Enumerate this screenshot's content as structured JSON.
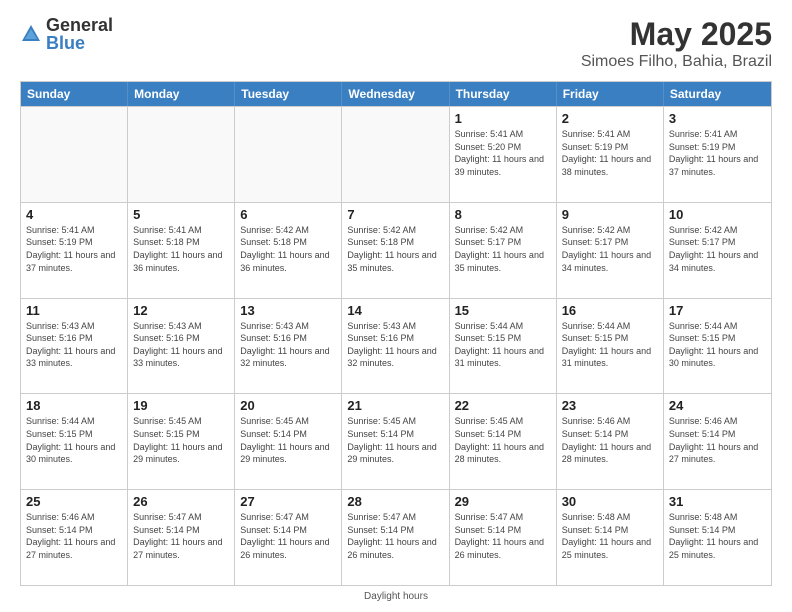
{
  "header": {
    "logo_general": "General",
    "logo_blue": "Blue",
    "title": "May 2025",
    "subtitle": "Simoes Filho, Bahia, Brazil"
  },
  "calendar": {
    "days_of_week": [
      "Sunday",
      "Monday",
      "Tuesday",
      "Wednesday",
      "Thursday",
      "Friday",
      "Saturday"
    ],
    "weeks": [
      [
        {
          "day": "",
          "info": ""
        },
        {
          "day": "",
          "info": ""
        },
        {
          "day": "",
          "info": ""
        },
        {
          "day": "",
          "info": ""
        },
        {
          "day": "1",
          "info": "Sunrise: 5:41 AM\nSunset: 5:20 PM\nDaylight: 11 hours and 39 minutes."
        },
        {
          "day": "2",
          "info": "Sunrise: 5:41 AM\nSunset: 5:19 PM\nDaylight: 11 hours and 38 minutes."
        },
        {
          "day": "3",
          "info": "Sunrise: 5:41 AM\nSunset: 5:19 PM\nDaylight: 11 hours and 37 minutes."
        }
      ],
      [
        {
          "day": "4",
          "info": "Sunrise: 5:41 AM\nSunset: 5:19 PM\nDaylight: 11 hours and 37 minutes."
        },
        {
          "day": "5",
          "info": "Sunrise: 5:41 AM\nSunset: 5:18 PM\nDaylight: 11 hours and 36 minutes."
        },
        {
          "day": "6",
          "info": "Sunrise: 5:42 AM\nSunset: 5:18 PM\nDaylight: 11 hours and 36 minutes."
        },
        {
          "day": "7",
          "info": "Sunrise: 5:42 AM\nSunset: 5:18 PM\nDaylight: 11 hours and 35 minutes."
        },
        {
          "day": "8",
          "info": "Sunrise: 5:42 AM\nSunset: 5:17 PM\nDaylight: 11 hours and 35 minutes."
        },
        {
          "day": "9",
          "info": "Sunrise: 5:42 AM\nSunset: 5:17 PM\nDaylight: 11 hours and 34 minutes."
        },
        {
          "day": "10",
          "info": "Sunrise: 5:42 AM\nSunset: 5:17 PM\nDaylight: 11 hours and 34 minutes."
        }
      ],
      [
        {
          "day": "11",
          "info": "Sunrise: 5:43 AM\nSunset: 5:16 PM\nDaylight: 11 hours and 33 minutes."
        },
        {
          "day": "12",
          "info": "Sunrise: 5:43 AM\nSunset: 5:16 PM\nDaylight: 11 hours and 33 minutes."
        },
        {
          "day": "13",
          "info": "Sunrise: 5:43 AM\nSunset: 5:16 PM\nDaylight: 11 hours and 32 minutes."
        },
        {
          "day": "14",
          "info": "Sunrise: 5:43 AM\nSunset: 5:16 PM\nDaylight: 11 hours and 32 minutes."
        },
        {
          "day": "15",
          "info": "Sunrise: 5:44 AM\nSunset: 5:15 PM\nDaylight: 11 hours and 31 minutes."
        },
        {
          "day": "16",
          "info": "Sunrise: 5:44 AM\nSunset: 5:15 PM\nDaylight: 11 hours and 31 minutes."
        },
        {
          "day": "17",
          "info": "Sunrise: 5:44 AM\nSunset: 5:15 PM\nDaylight: 11 hours and 30 minutes."
        }
      ],
      [
        {
          "day": "18",
          "info": "Sunrise: 5:44 AM\nSunset: 5:15 PM\nDaylight: 11 hours and 30 minutes."
        },
        {
          "day": "19",
          "info": "Sunrise: 5:45 AM\nSunset: 5:15 PM\nDaylight: 11 hours and 29 minutes."
        },
        {
          "day": "20",
          "info": "Sunrise: 5:45 AM\nSunset: 5:14 PM\nDaylight: 11 hours and 29 minutes."
        },
        {
          "day": "21",
          "info": "Sunrise: 5:45 AM\nSunset: 5:14 PM\nDaylight: 11 hours and 29 minutes."
        },
        {
          "day": "22",
          "info": "Sunrise: 5:45 AM\nSunset: 5:14 PM\nDaylight: 11 hours and 28 minutes."
        },
        {
          "day": "23",
          "info": "Sunrise: 5:46 AM\nSunset: 5:14 PM\nDaylight: 11 hours and 28 minutes."
        },
        {
          "day": "24",
          "info": "Sunrise: 5:46 AM\nSunset: 5:14 PM\nDaylight: 11 hours and 27 minutes."
        }
      ],
      [
        {
          "day": "25",
          "info": "Sunrise: 5:46 AM\nSunset: 5:14 PM\nDaylight: 11 hours and 27 minutes."
        },
        {
          "day": "26",
          "info": "Sunrise: 5:47 AM\nSunset: 5:14 PM\nDaylight: 11 hours and 27 minutes."
        },
        {
          "day": "27",
          "info": "Sunrise: 5:47 AM\nSunset: 5:14 PM\nDaylight: 11 hours and 26 minutes."
        },
        {
          "day": "28",
          "info": "Sunrise: 5:47 AM\nSunset: 5:14 PM\nDaylight: 11 hours and 26 minutes."
        },
        {
          "day": "29",
          "info": "Sunrise: 5:47 AM\nSunset: 5:14 PM\nDaylight: 11 hours and 26 minutes."
        },
        {
          "day": "30",
          "info": "Sunrise: 5:48 AM\nSunset: 5:14 PM\nDaylight: 11 hours and 25 minutes."
        },
        {
          "day": "31",
          "info": "Sunrise: 5:48 AM\nSunset: 5:14 PM\nDaylight: 11 hours and 25 minutes."
        }
      ]
    ],
    "footer": "Daylight hours"
  }
}
